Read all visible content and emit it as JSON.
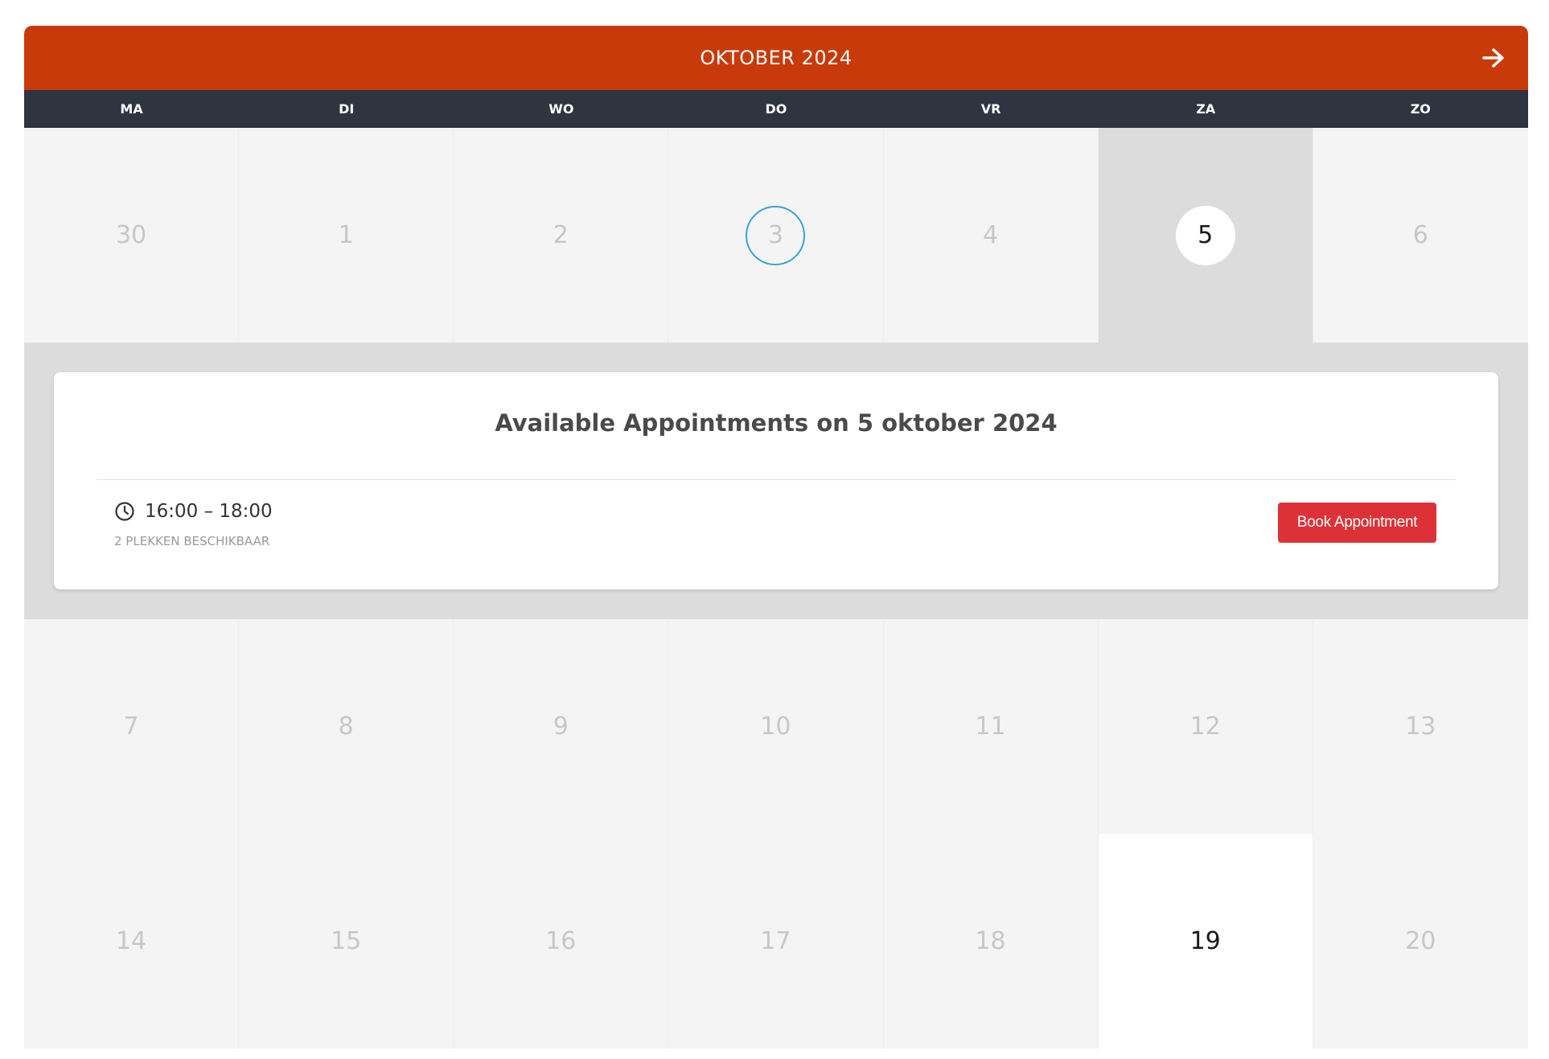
{
  "calendar": {
    "month_title": "OKTOBER 2024",
    "next_icon": "arrow-right-icon",
    "weekdays": [
      "MA",
      "DI",
      "WO",
      "DO",
      "VR",
      "ZA",
      "ZO"
    ],
    "weeks": [
      [
        "30",
        "1",
        "2",
        "3",
        "4",
        "5",
        "6"
      ],
      [
        "7",
        "8",
        "9",
        "10",
        "11",
        "12",
        "13"
      ],
      [
        "14",
        "15",
        "16",
        "17",
        "18",
        "19",
        "20"
      ]
    ],
    "today": "3",
    "selected": "5",
    "available_days": [
      "5",
      "19"
    ]
  },
  "appointments": {
    "title": "Available Appointments on 5 oktober 2024",
    "slots": [
      {
        "time": "16:00 – 18:00",
        "availability": "2 PLEKKEN BESCHIKBAAR",
        "button_label": "Book Appointment"
      }
    ]
  },
  "colors": {
    "header": "#c93a0a",
    "weekday_bar": "#2e3440",
    "today_ring": "#3aa3d6",
    "book_button": "#dc3237"
  }
}
